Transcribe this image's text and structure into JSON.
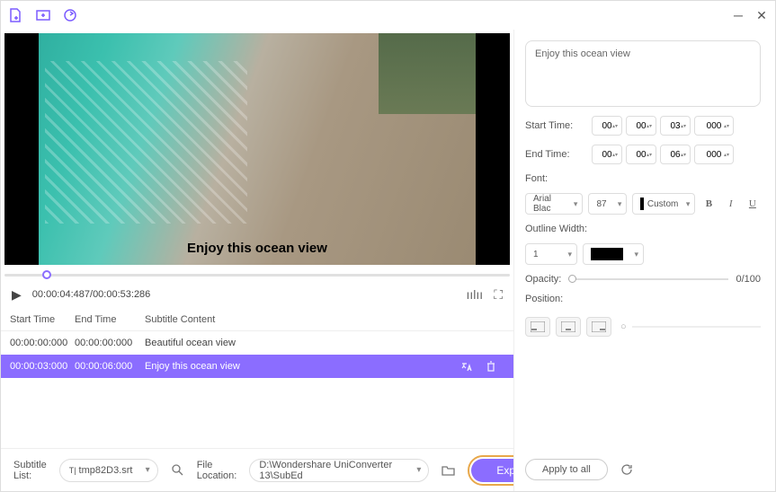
{
  "titlebar": {},
  "video": {
    "caption": "Enjoy this ocean view"
  },
  "playback": {
    "time": "00:00:04:487/00:00:53:286"
  },
  "table": {
    "headers": {
      "start": "Start Time",
      "end": "End Time",
      "content": "Subtitle Content"
    },
    "rows": [
      {
        "start": "00:00:00:000",
        "end": "00:00:00:000",
        "content": "Beautiful ocean view",
        "selected": false
      },
      {
        "start": "00:00:03:000",
        "end": "00:00:06:000",
        "content": "Enjoy this ocean view",
        "selected": true
      }
    ]
  },
  "bottom": {
    "subtitle_list_lbl": "Subtitle List:",
    "subtitle_file": "tmp82D3.srt",
    "file_location_lbl": "File Location:",
    "file_location": "D:\\Wondershare UniConverter 13\\SubEd",
    "export": "Export"
  },
  "right": {
    "text": "Enjoy this ocean view",
    "start_lbl": "Start Time:",
    "end_lbl": "End Time:",
    "start": {
      "h": "00",
      "m": "00",
      "s": "03",
      "ms": "000"
    },
    "end": {
      "h": "00",
      "m": "00",
      "s": "06",
      "ms": "000"
    },
    "font_lbl": "Font:",
    "font_name": "Arial Blac",
    "font_size": "87",
    "color_mode": "Custom",
    "outline_lbl": "Outline Width:",
    "outline_width": "1",
    "opacity_lbl": "Opacity:",
    "opacity_val": "0/100",
    "position_lbl": "Position:",
    "apply_lbl": "Apply to all"
  }
}
